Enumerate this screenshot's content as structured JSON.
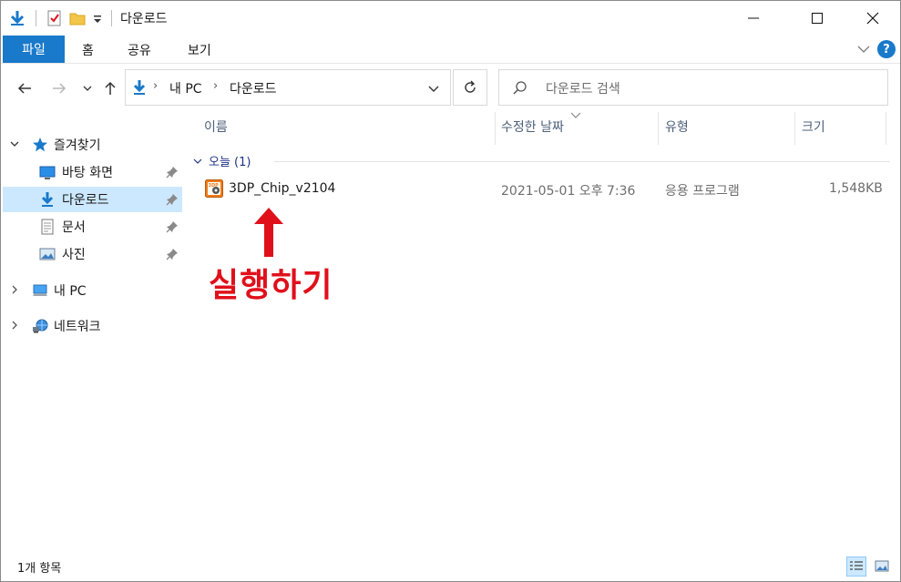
{
  "window": {
    "title": "다운로드"
  },
  "ribbon": {
    "tabs": [
      "파일",
      "홈",
      "공유",
      "보기"
    ],
    "help": "?"
  },
  "address": {
    "crumbs": [
      "내 PC",
      "다운로드"
    ]
  },
  "search": {
    "placeholder": "다운로드 검색"
  },
  "nav": {
    "quick_access": "즐겨찾기",
    "items": [
      {
        "label": "바탕 화면",
        "icon": "desktop-icon"
      },
      {
        "label": "다운로드",
        "icon": "download-arrow-icon",
        "selected": true
      },
      {
        "label": "문서",
        "icon": "document-icon"
      },
      {
        "label": "사진",
        "icon": "picture-icon"
      }
    ],
    "this_pc": "내 PC",
    "network": "네트워크"
  },
  "columns": [
    "이름",
    "수정한 날짜",
    "유형",
    "크기"
  ],
  "group": {
    "label": "오늘 (1)"
  },
  "files": [
    {
      "name": "3DP_Chip_v2104",
      "modified": "2021-05-01 오후 7:36",
      "type": "응용 프로그램",
      "size": "1,548KB",
      "icon": "3dp-app-icon"
    }
  ],
  "annotation": {
    "text": "실행하기",
    "color": "#e0101b"
  },
  "status": {
    "count": "1개 항목"
  },
  "colors": {
    "accent": "#1979ca",
    "selection": "#cce8ff",
    "annotation": "#e0101b"
  }
}
